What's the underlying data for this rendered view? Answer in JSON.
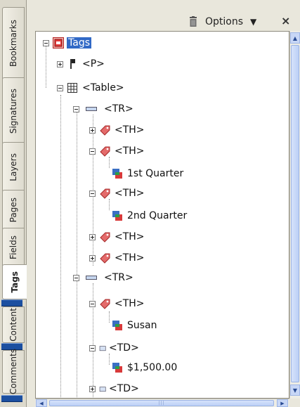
{
  "side_tabs": [
    {
      "label": "Bookmarks",
      "active": false
    },
    {
      "label": "Signatures",
      "active": false
    },
    {
      "label": "Layers",
      "active": false
    },
    {
      "label": "Pages",
      "active": false
    },
    {
      "label": "Fields",
      "active": false
    },
    {
      "label": "Tags",
      "active": true
    },
    {
      "label": "Content",
      "active": false
    },
    {
      "label": "Comments",
      "active": false
    }
  ],
  "header": {
    "trash_icon": "trash-icon",
    "options_label": "Options",
    "options_icon": "triangle-down-icon",
    "close_label": "×"
  },
  "tree": [
    {
      "label": "Tags",
      "icon": "tags-root-icon",
      "expander": "minus",
      "selected": true
    },
    {
      "label": "<P>",
      "icon": "paragraph-tag-icon",
      "expander": "plus"
    },
    {
      "label": "<Table>",
      "icon": "table-tag-icon",
      "expander": "minus"
    },
    {
      "label": "<TR>",
      "icon": "table-row-icon",
      "expander": "minus"
    },
    {
      "label": "<TH>",
      "icon": "tag-icon",
      "expander": "plus"
    },
    {
      "label": "<TH>",
      "icon": "tag-icon",
      "expander": "minus"
    },
    {
      "label": "1st Quarter",
      "icon": "content-item-icon",
      "expander": "none"
    },
    {
      "label": "<TH>",
      "icon": "tag-icon",
      "expander": "minus"
    },
    {
      "label": "2nd Quarter",
      "icon": "content-item-icon",
      "expander": "none"
    },
    {
      "label": "<TH>",
      "icon": "tag-icon",
      "expander": "plus"
    },
    {
      "label": "<TH>",
      "icon": "tag-icon",
      "expander": "plus"
    },
    {
      "label": "<TR>",
      "icon": "table-row-icon",
      "expander": "minus"
    },
    {
      "label": "<TH>",
      "icon": "tag-icon",
      "expander": "minus"
    },
    {
      "label": "Susan",
      "icon": "content-item-icon",
      "expander": "none"
    },
    {
      "label": "<TD>",
      "icon": "table-cell-icon",
      "expander": "minus"
    },
    {
      "label": "$1,500.00",
      "icon": "content-item-icon",
      "expander": "none"
    },
    {
      "label": "<TD>",
      "icon": "table-cell-icon",
      "expander": "plus"
    }
  ],
  "scrollbar_labels": {
    "up": "▲",
    "down": "▼",
    "left": "◀",
    "right": "▶"
  },
  "colors": {
    "selection": "#3169c6",
    "scroll_accent": "#c8d7f6"
  }
}
